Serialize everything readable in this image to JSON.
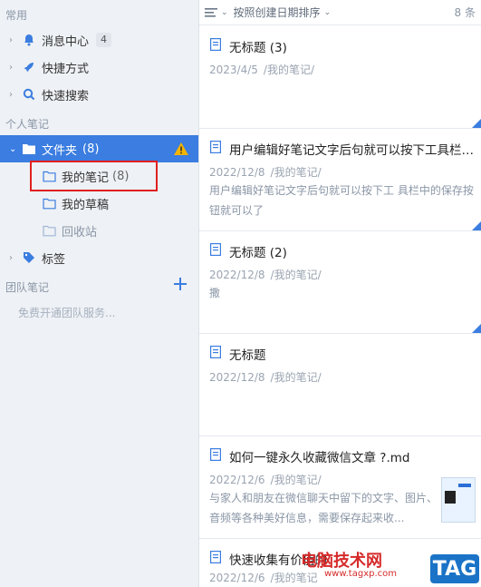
{
  "sidebar": {
    "section_common": "常用",
    "common_items": [
      {
        "label": "消息中心",
        "badge": "4"
      },
      {
        "label": "快捷方式"
      },
      {
        "label": "快速搜索"
      }
    ],
    "section_personal": "个人笔记",
    "folder": {
      "label": "文件夹",
      "count": "(8)"
    },
    "subfolders": [
      {
        "label": "我的笔记",
        "count": "(8)"
      },
      {
        "label": "我的草稿"
      },
      {
        "label": "回收站"
      }
    ],
    "tags_label": "标签",
    "section_team": "团队笔记",
    "team_upsell": "免费开通团队服务..."
  },
  "toolbar": {
    "sort_label": "按照创建日期排序",
    "count": "8 条"
  },
  "notes": [
    {
      "title": "无标题 (3)",
      "date": "2023/4/5",
      "path": "/我的笔记/",
      "snippet": ""
    },
    {
      "title": "用户编辑好笔记文字后句就可以按下工具栏中的保存按钮就可以了",
      "date": "2022/12/8",
      "path": "/我的笔记/",
      "snippet": "用户编辑好笔记文字后句就可以按下工 具栏中的保存按钮就可以了"
    },
    {
      "title": "无标题 (2)",
      "date": "2022/12/8",
      "path": "/我的笔记/",
      "snippet": "撒"
    },
    {
      "title": "无标题",
      "date": "2022/12/8",
      "path": "/我的笔记/",
      "snippet": ""
    },
    {
      "title": "如何一键永久收藏微信文章 ?.md",
      "date": "2022/12/6",
      "path": "/我的笔记/",
      "snippet": " 与家人和朋友在微信聊天中留下的文字、图片、音频等各种美好信息，需要保存起来收..."
    },
    {
      "title": "快速收集有价值的",
      "date": "2022/12/6",
      "path": "/我的笔记",
      "snippet": ""
    }
  ],
  "watermark": {
    "text": "电脑技术网",
    "url": "www.tagxp.com",
    "badge": "TAG"
  },
  "colors": {
    "accent": "#3b7de0",
    "warning": "#f5b400",
    "highlight": "#e02020"
  }
}
